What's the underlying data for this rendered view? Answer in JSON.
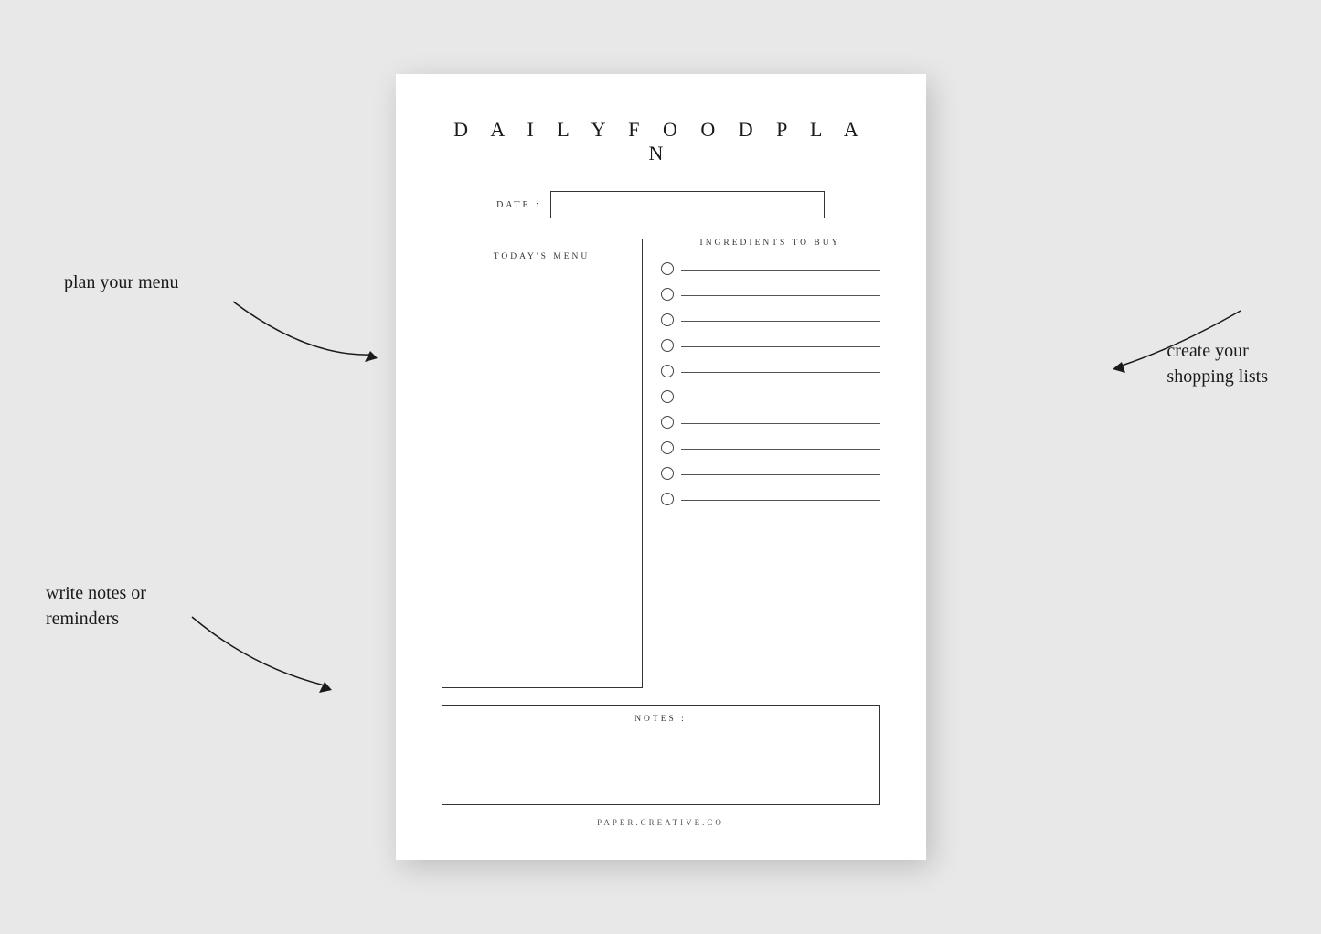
{
  "background_color": "#e8e8e8",
  "annotations": {
    "plan_menu": "plan your menu",
    "shopping_lists_line1": "create your",
    "shopping_lists_line2": "shopping lists",
    "notes_reminders_line1": "write notes or",
    "notes_reminders_line2": "reminders"
  },
  "document": {
    "title": "D A I L Y   F O O D   P L A N",
    "date_label": "DATE :",
    "date_value": "",
    "todays_menu_label": "TODAY'S MENU",
    "ingredients_title": "INGREDIENTS TO BUY",
    "ingredient_count": 10,
    "notes_label": "NOTES :",
    "footer": "PAPER.CREATIVE.CO"
  }
}
